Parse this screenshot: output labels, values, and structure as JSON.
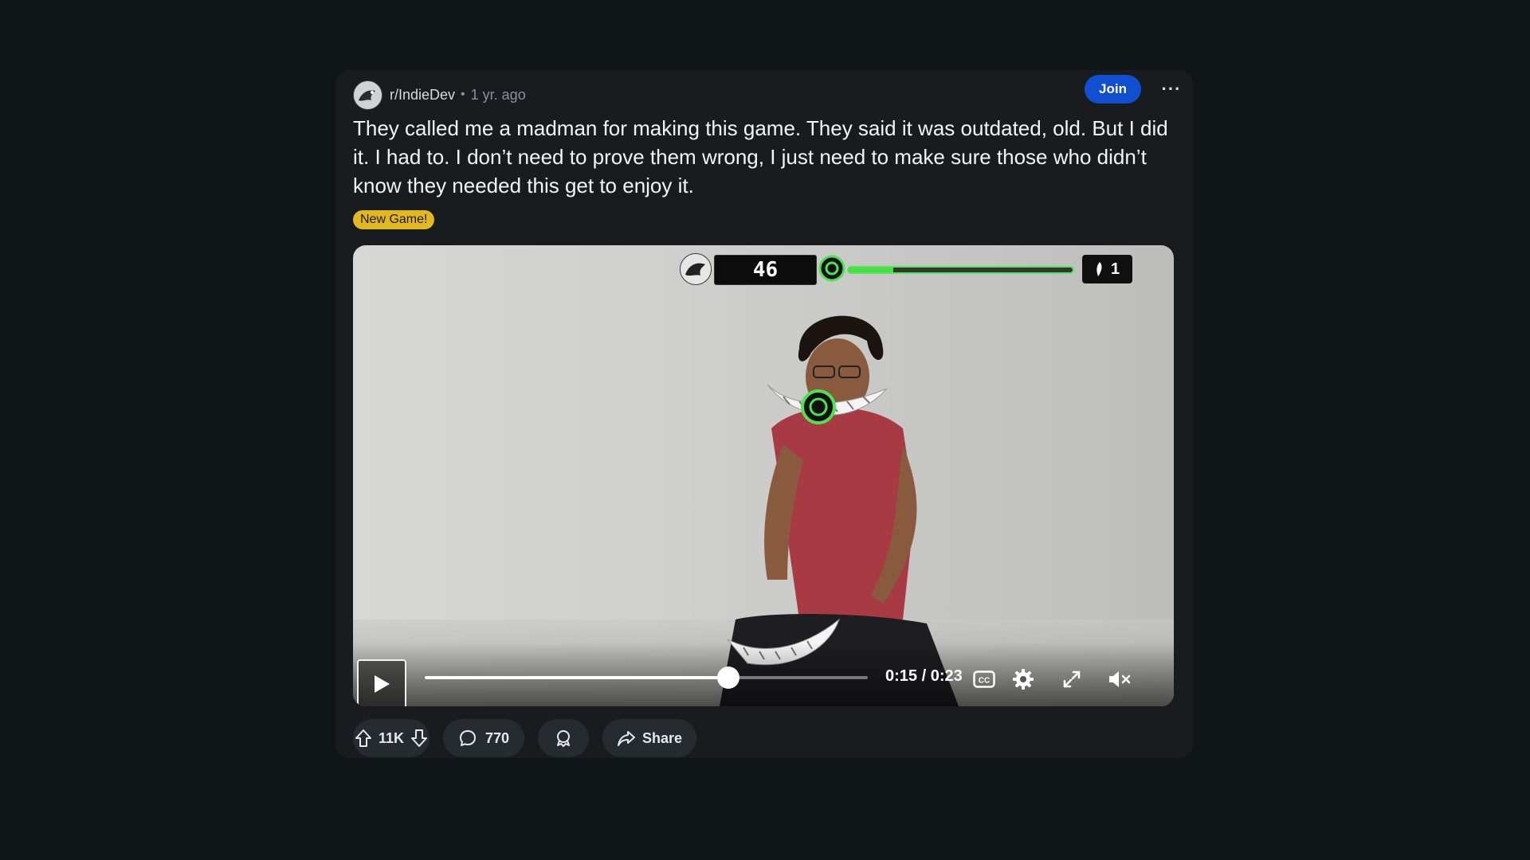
{
  "post": {
    "subreddit": "r/IndieDev",
    "separator": "•",
    "age": "1 yr. ago",
    "join_label": "Join",
    "more_label": "···",
    "title": "They called me a madman for making this game. They said it was outdated, old. But I did it. I had to. I don’t need to prove them wrong, I just need to make sure those who didn’t know they needed this get to enjoy it.",
    "flair": "New Game!"
  },
  "video": {
    "hud": {
      "score": "46",
      "energy_fraction": 0.2,
      "lives": "1"
    },
    "player": {
      "time": "0:15 / 0:23",
      "progress_fraction": 0.685
    }
  },
  "actions": {
    "votes": "11K",
    "comments": "770",
    "share_label": "Share"
  },
  "colors": {
    "background": "#101517",
    "card": "#181c1f",
    "join": "#0f4fd0",
    "flair": "#e2b81e",
    "hud_green": "#46e046"
  },
  "icons": [
    "subreddit-avatar",
    "more-icon",
    "play-icon",
    "cc-icon",
    "settings-gear-icon",
    "fullscreen-icon",
    "mute-icon",
    "upvote-icon",
    "downvote-icon",
    "comment-icon",
    "award-icon",
    "share-icon",
    "target-ring-icon",
    "feather-icon"
  ]
}
